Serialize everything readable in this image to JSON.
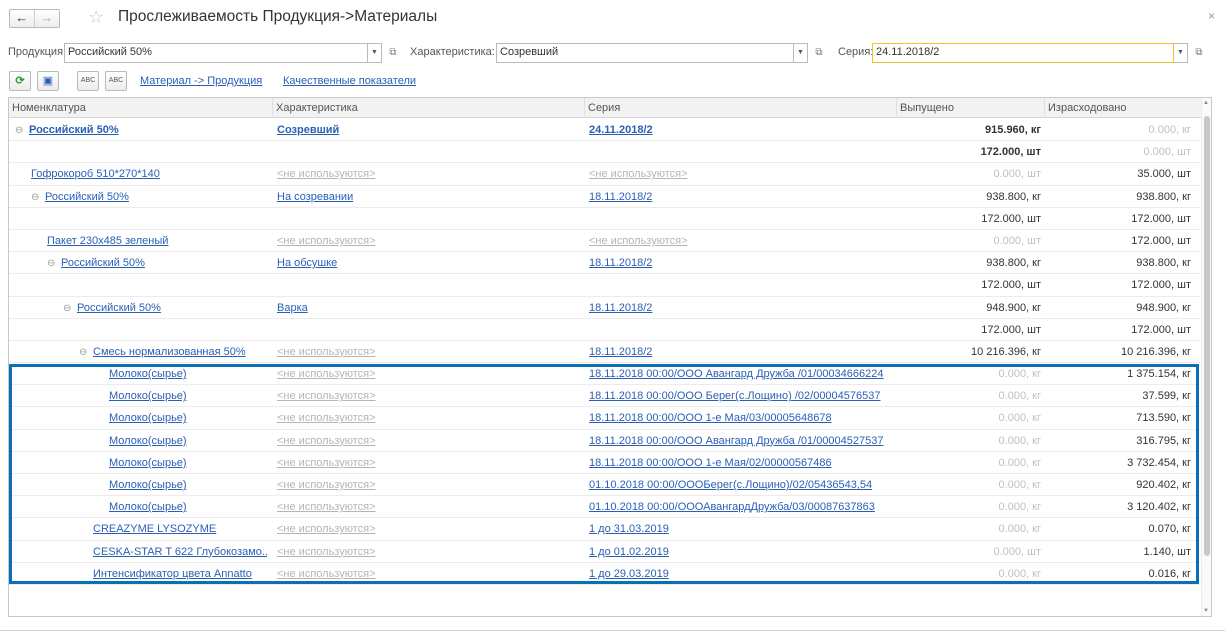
{
  "window": {
    "title": "Прослеживаемость Продукция->Материалы",
    "close": "×"
  },
  "nav": {
    "back": "←",
    "forward": "→",
    "star": "☆"
  },
  "filters": {
    "product_label": "Продукция:",
    "product_value": "Российский 50%",
    "characteristic_label": "Характеристика:",
    "characteristic_value": "Созревший",
    "series_label": "Серия:",
    "series_value": "24.11.2018/2"
  },
  "toolbar": {
    "refresh_icon": "refresh-icon",
    "link_material_product": "Материал -> Продукция",
    "link_quality": "Качественные показатели"
  },
  "columns": [
    "Номенклатура",
    "Характеристика",
    "Серия",
    "Выпущено",
    "Израсходовано"
  ],
  "rows": [
    {
      "indent": 0,
      "toggle": "⊖",
      "name": "Российский 50%",
      "char": "Созревший",
      "series": "24.11.2018/2",
      "released": "915.960, кг",
      "consumed": "0.000, кг",
      "bold": true,
      "rel_bold": true,
      "rel_gray": false,
      "con_gray": true,
      "char_gray": false,
      "ser_gray": false
    },
    {
      "indent": 0,
      "toggle": "",
      "name": "",
      "char": "",
      "series": "",
      "released": "172.000, шт",
      "consumed": "0.000, шт",
      "bold": false,
      "rel_bold": true,
      "rel_gray": false,
      "con_gray": true,
      "char_gray": false,
      "ser_gray": false
    },
    {
      "indent": 1,
      "toggle": "",
      "name": "Гофрокороб 510*270*140",
      "char": "<не используются>",
      "series": "<не используются>",
      "released": "0.000, шт",
      "consumed": "35.000, шт",
      "bold": false,
      "rel_bold": false,
      "rel_gray": true,
      "con_gray": false,
      "char_gray": true,
      "ser_gray": true
    },
    {
      "indent": 1,
      "toggle": "⊖",
      "name": "Российский 50%",
      "char": "На созревании",
      "series": "18.11.2018/2",
      "released": "938.800, кг",
      "consumed": "938.800, кг",
      "bold": false,
      "rel_bold": false,
      "rel_gray": false,
      "con_gray": false,
      "char_gray": false,
      "ser_gray": false
    },
    {
      "indent": 1,
      "toggle": "",
      "name": "",
      "char": "",
      "series": "",
      "released": "172.000, шт",
      "consumed": "172.000, шт",
      "bold": false,
      "rel_bold": false,
      "rel_gray": false,
      "con_gray": false,
      "char_gray": false,
      "ser_gray": false
    },
    {
      "indent": 2,
      "toggle": "",
      "name": "Пакет 230х485 зеленый",
      "char": "<не используются>",
      "series": "<не используются>",
      "released": "0.000, шт",
      "consumed": "172.000, шт",
      "bold": false,
      "rel_bold": false,
      "rel_gray": true,
      "con_gray": false,
      "char_gray": true,
      "ser_gray": true
    },
    {
      "indent": 2,
      "toggle": "⊖",
      "name": "Российский 50%",
      "char": "На обсушке",
      "series": "18.11.2018/2",
      "released": "938.800, кг",
      "consumed": "938.800, кг",
      "bold": false,
      "rel_bold": false,
      "rel_gray": false,
      "con_gray": false,
      "char_gray": false,
      "ser_gray": false
    },
    {
      "indent": 2,
      "toggle": "",
      "name": "",
      "char": "",
      "series": "",
      "released": "172.000, шт",
      "consumed": "172.000, шт",
      "bold": false,
      "rel_bold": false,
      "rel_gray": false,
      "con_gray": false,
      "char_gray": false,
      "ser_gray": false
    },
    {
      "indent": 3,
      "toggle": "⊖",
      "name": "Российский 50%",
      "char": "Варка",
      "series": "18.11.2018/2",
      "released": "948.900, кг",
      "consumed": "948.900, кг",
      "bold": false,
      "rel_bold": false,
      "rel_gray": false,
      "con_gray": false,
      "char_gray": false,
      "ser_gray": false
    },
    {
      "indent": 3,
      "toggle": "",
      "name": "",
      "char": "",
      "series": "",
      "released": "172.000, шт",
      "consumed": "172.000, шт",
      "bold": false,
      "rel_bold": false,
      "rel_gray": false,
      "con_gray": false,
      "char_gray": false,
      "ser_gray": false
    },
    {
      "indent": 4,
      "toggle": "⊖",
      "name": "Смесь нормализованная 50%",
      "char": "<не используются>",
      "series": "18.11.2018/2",
      "released": "10 216.396, кг",
      "consumed": "10 216.396, кг",
      "bold": false,
      "rel_bold": false,
      "rel_gray": false,
      "con_gray": false,
      "char_gray": true,
      "ser_gray": false
    },
    {
      "indent": 6,
      "toggle": "",
      "name": "Молоко(сырье)",
      "char": "<не используются>",
      "series": "18.11.2018 00:00/ООО Авангард Дружба  /01/00034666224",
      "released": "0.000, кг",
      "consumed": "1 375.154, кг",
      "bold": false,
      "rel_bold": false,
      "rel_gray": true,
      "con_gray": false,
      "char_gray": true,
      "ser_gray": false
    },
    {
      "indent": 6,
      "toggle": "",
      "name": "Молоко(сырье)",
      "char": "<не используются>",
      "series": "18.11.2018 00:00/ООО Берег(с.Лощино) /02/00004576537",
      "released": "0.000, кг",
      "consumed": "37.599, кг",
      "bold": false,
      "rel_bold": false,
      "rel_gray": true,
      "con_gray": false,
      "char_gray": true,
      "ser_gray": false
    },
    {
      "indent": 6,
      "toggle": "",
      "name": "Молоко(сырье)",
      "char": "<не используются>",
      "series": "18.11.2018 00:00/ООО 1-е Мая/03/00005648678",
      "released": "0.000, кг",
      "consumed": "713.590, кг",
      "bold": false,
      "rel_bold": false,
      "rel_gray": true,
      "con_gray": false,
      "char_gray": true,
      "ser_gray": false
    },
    {
      "indent": 6,
      "toggle": "",
      "name": "Молоко(сырье)",
      "char": "<не используются>",
      "series": "18.11.2018 00:00/ООО Авангард Дружба  /01/00004527537",
      "released": "0.000, кг",
      "consumed": "316.795, кг",
      "bold": false,
      "rel_bold": false,
      "rel_gray": true,
      "con_gray": false,
      "char_gray": true,
      "ser_gray": false
    },
    {
      "indent": 6,
      "toggle": "",
      "name": "Молоко(сырье)",
      "char": "<не используются>",
      "series": "18.11.2018 00:00/ООО 1-е Мая/02/00000567486",
      "released": "0.000, кг",
      "consumed": "3 732.454, кг",
      "bold": false,
      "rel_bold": false,
      "rel_gray": true,
      "con_gray": false,
      "char_gray": true,
      "ser_gray": false
    },
    {
      "indent": 6,
      "toggle": "",
      "name": "Молоко(сырье)",
      "char": "<не используются>",
      "series": "01.10.2018 00:00/ОООБерег(с.Лощино)/02/05436543,54",
      "released": "0.000, кг",
      "consumed": "920.402, кг",
      "bold": false,
      "rel_bold": false,
      "rel_gray": true,
      "con_gray": false,
      "char_gray": true,
      "ser_gray": false
    },
    {
      "indent": 6,
      "toggle": "",
      "name": "Молоко(сырье)",
      "char": "<не используются>",
      "series": "01.10.2018 00:00/ОООАвангардДружба/03/00087637863",
      "released": "0.000, кг",
      "consumed": "3 120.402, кг",
      "bold": false,
      "rel_bold": false,
      "rel_gray": true,
      "con_gray": false,
      "char_gray": true,
      "ser_gray": false
    },
    {
      "indent": 5,
      "toggle": "",
      "name": "CREAZYME LYSOZYME",
      "char": "<не используются>",
      "series": "1 до 31.03.2019",
      "released": "0.000, кг",
      "consumed": "0.070, кг",
      "bold": false,
      "rel_bold": false,
      "rel_gray": true,
      "con_gray": false,
      "char_gray": true,
      "ser_gray": false
    },
    {
      "indent": 5,
      "toggle": "",
      "name": "CESKA-STAR T 622 Глубокозамо...",
      "char": "<не используются>",
      "series": "1 до 01.02.2019",
      "released": "0.000, шт",
      "consumed": "1.140, шт",
      "bold": false,
      "rel_bold": false,
      "rel_gray": true,
      "con_gray": false,
      "char_gray": true,
      "ser_gray": false
    },
    {
      "indent": 5,
      "toggle": "",
      "name": "Интенсификатор цвета Annatto",
      "char": "<не используются>",
      "series": "1 до 29.03.2019",
      "released": "0.000, кг",
      "consumed": "0.016, кг",
      "bold": false,
      "rel_bold": false,
      "rel_gray": true,
      "con_gray": false,
      "char_gray": true,
      "ser_gray": false
    }
  ]
}
